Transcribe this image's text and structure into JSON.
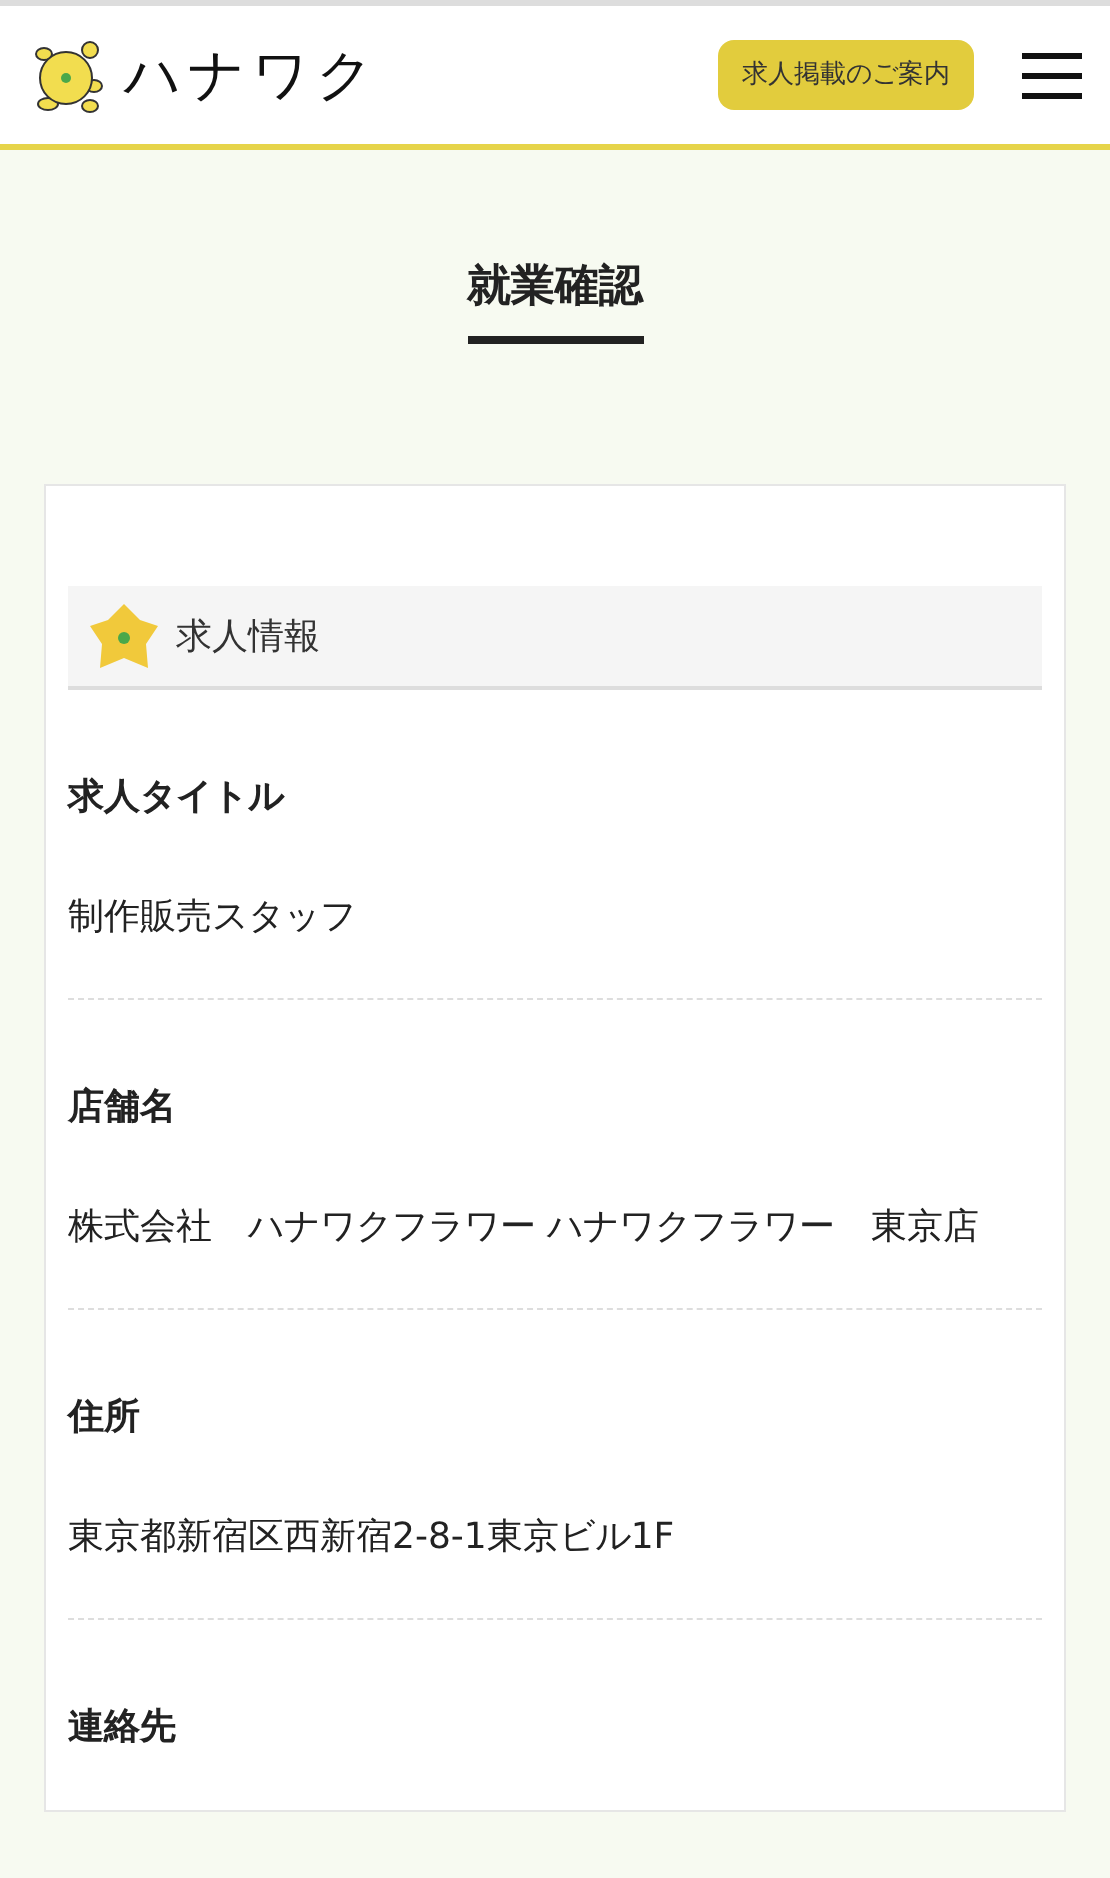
{
  "header": {
    "logo_text": "ハナワク",
    "cta_button": "求人掲載のご案内"
  },
  "page_title": "就業確認",
  "section": {
    "title": "求人情報",
    "fields": [
      {
        "label": "求人タイトル",
        "value": "制作販売スタッフ"
      },
      {
        "label": "店舗名",
        "value": "株式会社　ハナワクフラワー ハナワクフラワー　東京店"
      },
      {
        "label": "住所",
        "value": "東京都新宿区西新宿2-8-1東京ビル1F"
      },
      {
        "label": "連絡先"
      }
    ]
  }
}
